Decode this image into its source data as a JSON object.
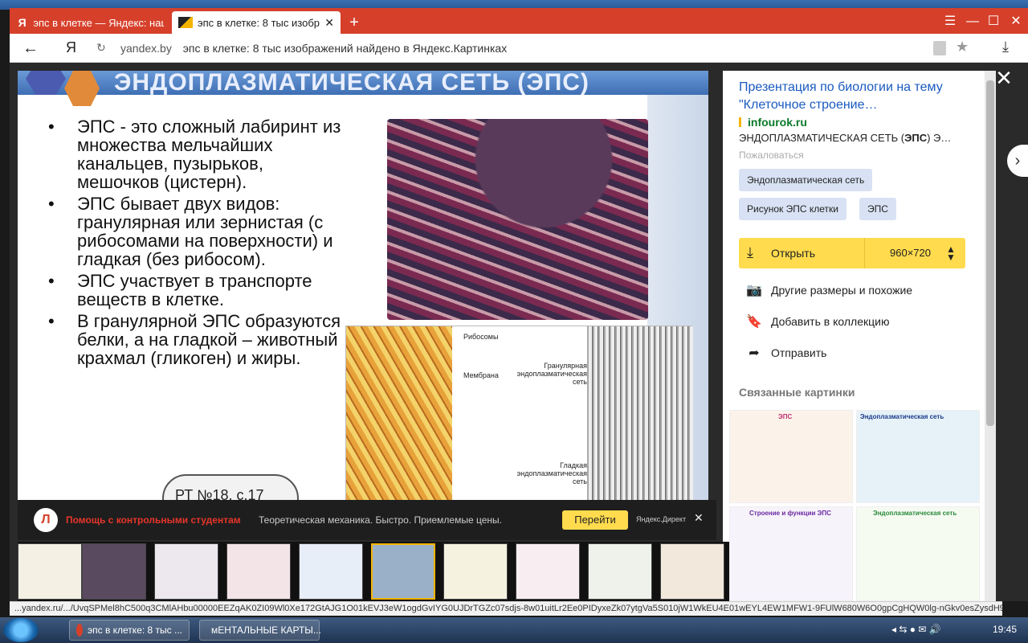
{
  "browser": {
    "tabs": [
      {
        "label": "эпс в клетке — Яндекс: наш",
        "active": false
      },
      {
        "label": "эпс в клетке: 8 тыс изобр",
        "active": true
      }
    ],
    "address": {
      "domain": "yandex.by",
      "title": "эпс в клетке: 8 тыс изображений найдено в Яндекс.Картинках"
    }
  },
  "slide": {
    "title": "ЭНДОПЛАЗМАТИЧЕСКАЯ СЕТЬ (ЭПС)",
    "bullets": [
      "ЭПС - это сложный лабиринт из множества мельчайших канальцев, пузырьков, мешочков (цистерн).",
      "ЭПС бывает двух видов: гранулярная или зернистая (с рибосомами на поверхности) и гладкая (без рибосом).",
      "ЭПС участвует в транспорте веществ в клетке.",
      "В гранулярной ЭПС образуются белки, а на гладкой – животный крахмал (гликоген) и жиры."
    ],
    "badge": "РТ №18, с.17",
    "diagram_labels": {
      "ribosomes": "Рибосомы",
      "membrane": "Мембрана",
      "granular": "Гранулярная эндоплазматическая сеть",
      "smooth": "Гладкая эндоплазматическая сеть"
    }
  },
  "panel": {
    "title": "Презентация по биологии на тему \"Клеточное строение…",
    "source": "infourok.ru",
    "desc_plain_1": "ЭНДОПЛАЗМАТИЧЕСКАЯ СЕТЬ (",
    "desc_bold": "ЭПС",
    "desc_plain_2": ") Э…",
    "complain": "Пожаловаться",
    "tags": [
      "Эндоплазматическая сеть",
      "Рисунок ЭПС клетки",
      "ЭПС"
    ],
    "open_label": "Открыть",
    "size": "960×720",
    "actions": [
      "Другие размеры и похожие",
      "Добавить в коллекцию",
      "Отправить"
    ],
    "related_heading": "Связанные картинки",
    "related": [
      "ЭПС",
      "Эндоплазматическая сеть",
      "Строение и функции ЭПС",
      "Эндоплазматическая сеть"
    ]
  },
  "ad": {
    "headline": "Помощь с контрольными студентам",
    "text": "Теоретическая механика. Быстро. Приемлемые цены.",
    "button": "Перейти",
    "direct": "Яндекс.Директ"
  },
  "status_url": "...yandex.ru/.../UvqSPMel8hC500q3CMlAHbu00000EEZqAK0ZI09Wl0Xe172GtAJG1O01kEVJ3eW1ogdGvIYG0UJDrTGZc07sdjs-8w01uitLr2Ee0PIDyxeZk07ytgVa5S010jW1WkEU4E01wEYL4EW1MFW1-9FUlW680W6O0gpCgHQW0lg-nGkv0esZysdH99ATy0Ahp...",
  "taskbar": {
    "apps": [
      "эпс в клетке: 8 тыс ...",
      "мЕНТАЛЬНЫЕ КАРТЫ..."
    ],
    "clock": "19:45"
  },
  "colors": {
    "yandex_red": "#d6402b",
    "accent_yellow": "#ffdb4d",
    "link_blue": "#1a5ac0"
  }
}
